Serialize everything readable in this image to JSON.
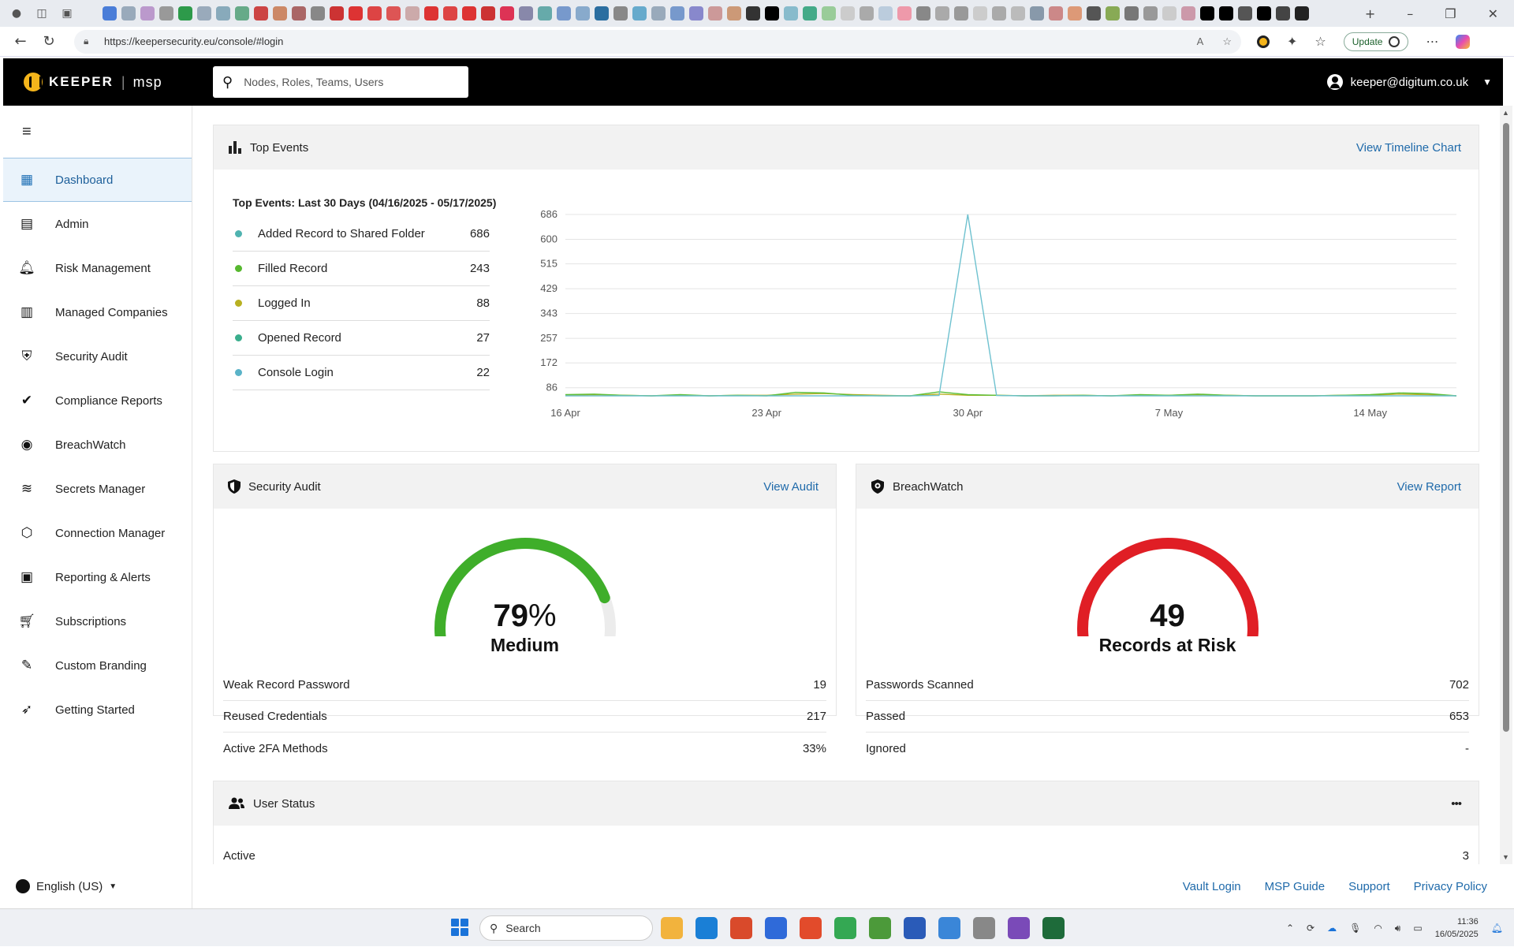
{
  "browser": {
    "url": "https://keepersecurity.eu/console/#login",
    "update_label": "Update",
    "favicon_colors": [
      "#4a7dd8",
      "#9ab",
      "#b9c",
      "#999",
      "#2d9a4a",
      "#9ab",
      "#8ab",
      "#6a8",
      "#c44",
      "#c86",
      "#a66",
      "#888",
      "#c33",
      "#d33",
      "#d44",
      "#d55",
      "#caa",
      "#d33",
      "#d44",
      "#d33",
      "#c33",
      "#d35",
      "#88a",
      "#6aa",
      "#79c",
      "#8ac",
      "#2b6ea0",
      "#888",
      "#6ac",
      "#9ab",
      "#79c",
      "#88c",
      "#c99",
      "#c97",
      "#333",
      "#000",
      "#8bc",
      "#4a8",
      "#9c9",
      "#ccc",
      "#aaa",
      "#bcd",
      "#e9a",
      "#888",
      "#aaa",
      "#999",
      "#ccc",
      "#aaa",
      "#bbb",
      "#89a",
      "#c88",
      "#d97",
      "#555",
      "#8a5",
      "#777",
      "#999",
      "#ccc",
      "#c9a",
      "#000",
      "#000",
      "#555",
      "#000",
      "#444",
      "#222"
    ]
  },
  "header": {
    "logo_text": "KEEPER",
    "logo_sub": "msp",
    "search_placeholder": "Nodes, Roles, Teams, Users",
    "user_email": "keeper@digitum.co.uk"
  },
  "sidebar": {
    "items": [
      {
        "label": "Dashboard",
        "icon": "dashboard-icon"
      },
      {
        "label": "Admin",
        "icon": "admin-icon"
      },
      {
        "label": "Risk Management",
        "icon": "bell-icon"
      },
      {
        "label": "Managed Companies",
        "icon": "building-icon"
      },
      {
        "label": "Security Audit",
        "icon": "shield-icon"
      },
      {
        "label": "Compliance Reports",
        "icon": "shield-check-icon"
      },
      {
        "label": "BreachWatch",
        "icon": "breachwatch-icon"
      },
      {
        "label": "Secrets Manager",
        "icon": "layers-icon"
      },
      {
        "label": "Connection Manager",
        "icon": "connection-icon"
      },
      {
        "label": "Reporting & Alerts",
        "icon": "clipboard-icon"
      },
      {
        "label": "Subscriptions",
        "icon": "cart-icon"
      },
      {
        "label": "Custom Branding",
        "icon": "brush-icon"
      },
      {
        "label": "Getting Started",
        "icon": "rocket-icon"
      }
    ],
    "language": "English (US)"
  },
  "top_events": {
    "header": "Top Events",
    "link": "View Timeline Chart",
    "subtitle": "Top Events: Last 30 Days (04/16/2025 - 05/17/2025)",
    "events": [
      {
        "name": "Added Record to Shared Folder",
        "count": "686",
        "color": "#4fb3b0"
      },
      {
        "name": "Filled Record",
        "count": "243",
        "color": "#57b82f"
      },
      {
        "name": "Logged In",
        "count": "88",
        "color": "#b8b021"
      },
      {
        "name": "Opened Record",
        "count": "27",
        "color": "#3aae8d"
      },
      {
        "name": "Console Login",
        "count": "22",
        "color": "#5ab3c8"
      }
    ]
  },
  "chart_data": {
    "type": "line",
    "ytick_labels": [
      "86",
      "172",
      "257",
      "343",
      "429",
      "515",
      "600",
      "686"
    ],
    "xtick_labels": [
      "16 Apr",
      "23 Apr",
      "30 Apr",
      "7 May",
      "14 May"
    ],
    "ylim": [
      58,
      686
    ],
    "x_start": "2025-04-16",
    "x_end": "2025-05-17",
    "series": [
      {
        "name": "Added Record to Shared Folder",
        "color": "#6ec1cf",
        "values": [
          58,
          58,
          58,
          58,
          58,
          58,
          58,
          58,
          58,
          58,
          58,
          58,
          58,
          59,
          686,
          59,
          58,
          58,
          58,
          58,
          58,
          58,
          58,
          58,
          58,
          58,
          58,
          58,
          58,
          58,
          58,
          58
        ]
      },
      {
        "name": "Filled Record",
        "color": "#5cbf3a",
        "values": [
          62,
          64,
          60,
          58,
          62,
          58,
          60,
          58,
          70,
          68,
          60,
          58,
          58,
          72,
          62,
          60,
          58,
          58,
          60,
          58,
          62,
          60,
          64,
          60,
          58,
          58,
          58,
          60,
          62,
          68,
          66,
          58
        ]
      },
      {
        "name": "Logged In",
        "color": "#b8b021",
        "values": [
          60,
          62,
          60,
          58,
          60,
          58,
          60,
          60,
          64,
          66,
          62,
          60,
          58,
          64,
          60,
          60,
          58,
          60,
          60,
          58,
          60,
          60,
          62,
          60,
          58,
          58,
          58,
          60,
          60,
          64,
          62,
          58
        ]
      }
    ]
  },
  "security_audit": {
    "header": "Security Audit",
    "link": "View Audit",
    "score_number": "79",
    "score_unit": "%",
    "score_fraction": 0.79,
    "level": "Medium",
    "gauge_color": "#3fae2a",
    "stats": [
      {
        "label": "Weak Record Password",
        "value": "19"
      },
      {
        "label": "Reused Credentials",
        "value": "217"
      },
      {
        "label": "Active 2FA Methods",
        "value": "33%"
      }
    ]
  },
  "breachwatch": {
    "header": "BreachWatch",
    "link": "View Report",
    "records_at_risk": "49",
    "label": "Records at Risk",
    "gauge_color": "#e01e25",
    "stats": [
      {
        "label": "Passwords Scanned",
        "value": "702"
      },
      {
        "label": "Passed",
        "value": "653"
      },
      {
        "label": "Ignored",
        "value": "-"
      }
    ]
  },
  "user_status": {
    "header": "User Status",
    "more": "•••",
    "rows": [
      {
        "label": "Active",
        "value": "3"
      }
    ]
  },
  "footer": {
    "links": [
      "Vault Login",
      "MSP Guide",
      "Support",
      "Privacy Policy"
    ]
  },
  "taskbar": {
    "search_placeholder": "Search",
    "time": "11:36",
    "date": "16/05/2025",
    "app_colors": [
      "#f2b33d",
      "#1a7fd6",
      "#d94a2b",
      "#2f6ad9",
      "#e24b2b",
      "#34a853",
      "#4c9a3a",
      "#2a5bb8",
      "#3a86d8",
      "#888",
      "#7a4ab8",
      "#1e6b3a"
    ]
  }
}
